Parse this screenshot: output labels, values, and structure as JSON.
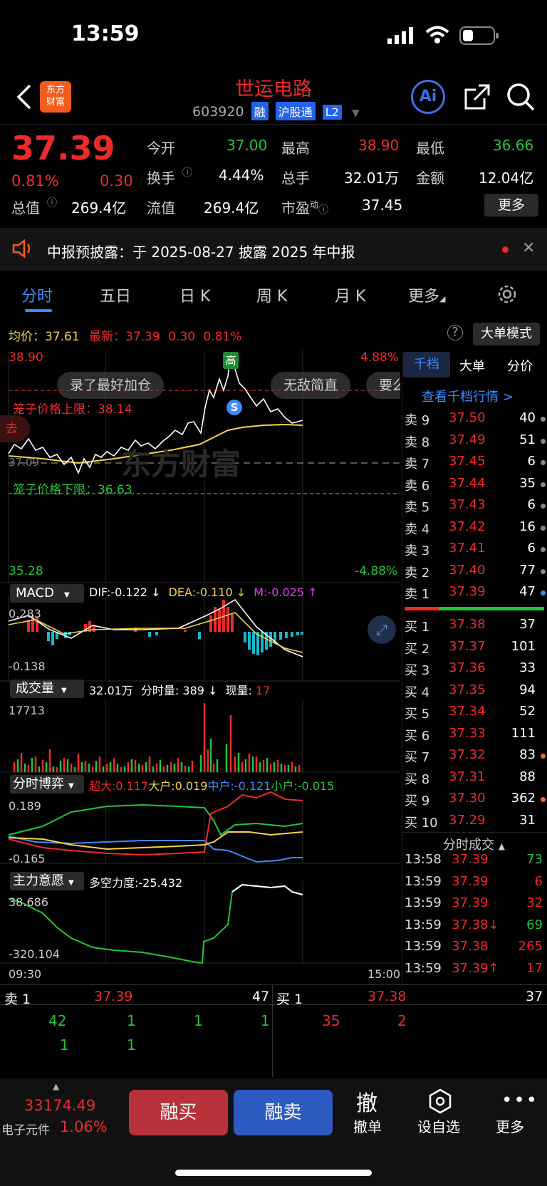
{
  "status_bar": {
    "time": "13:59"
  },
  "header": {
    "logo": "东方\n财富",
    "stock_name": "世运电路",
    "stock_code": "603920",
    "tags": [
      "融",
      "沪股通",
      "L2"
    ],
    "ai": "Ai"
  },
  "quote": {
    "price": "37.39",
    "change_pct": "0.81%",
    "change": "0.30",
    "fields": [
      {
        "label": "今开",
        "value": "37.00"
      },
      {
        "label": "最高",
        "value": "38.90"
      },
      {
        "label": "最低",
        "value": "36.66"
      },
      {
        "label": "换手",
        "value": "4.44%"
      },
      {
        "label": "总手",
        "value": "32.01万"
      },
      {
        "label": "金额",
        "value": "12.04亿"
      },
      {
        "label": "总值",
        "value": "269.4亿"
      },
      {
        "label": "流值",
        "value": "269.4亿"
      },
      {
        "label": "市盈",
        "sup": "动",
        "value": "37.45"
      }
    ],
    "more": "更多"
  },
  "notice": {
    "text": "中报预披露：于 2025-08-27 披露 2025 年中报"
  },
  "tabs": [
    "分时",
    "五日",
    "日 K",
    "周 K",
    "月 K",
    "更多"
  ],
  "intraday": {
    "avg_label": "均价：",
    "avg_value": "37.61",
    "last_label": "最新：",
    "last_value": "37.39",
    "last_change": "0.30",
    "last_pct": "0.81%",
    "big_order_mode": "大单模式",
    "y_top": "38.90",
    "y_bottom": "35.28",
    "pct_top": "4.88%",
    "pct_bottom": "-4.88%",
    "high_marker": "高",
    "s_marker": "S",
    "upper_limit": "笼子价格上限：38.14",
    "lower_limit": "笼子价格下限：36.63",
    "mid_price": "37.09",
    "bubbles": [
      "录了最好加仓",
      "无敌简直",
      "要么"
    ],
    "watermark": "东方财富",
    "time_start": "09:30",
    "time_end": "15:00",
    "side_label": "去"
  },
  "macd": {
    "name": "MACD",
    "dif": "DIF:-0.122 ↓",
    "dea": "DEA:-0.110 ↓",
    "m": "M:-0.025 ↑",
    "y_top": "0.283",
    "y_bottom": "-0.138"
  },
  "volume": {
    "name": "成交量",
    "total": "32.01万",
    "min_label": "分时量: 389 ↓",
    "cur_label": "现量:",
    "cur_value": "17",
    "y_top": "17713"
  },
  "game": {
    "name": "分时博弈",
    "super": "超大:0.117",
    "big": "大户:0.019",
    "mid": "中户:-0.121",
    "small": "小户:-0.015",
    "y_top": "0.189",
    "y_bottom": "-0.165"
  },
  "main_force": {
    "name": "主力意愿",
    "force": "多空力度:-25.432",
    "y_top": "38.686",
    "y_bottom": "-320.104"
  },
  "side_tabs": [
    "千档",
    "大单",
    "分价"
  ],
  "view_levels": "查看千档行情 >",
  "asks": [
    {
      "label": "卖 9",
      "price": "37.50",
      "vol": "40"
    },
    {
      "label": "卖 8",
      "price": "37.49",
      "vol": "51"
    },
    {
      "label": "卖 7",
      "price": "37.45",
      "vol": "6"
    },
    {
      "label": "卖 6",
      "price": "37.44",
      "vol": "35"
    },
    {
      "label": "卖 5",
      "price": "37.43",
      "vol": "6"
    },
    {
      "label": "卖 4",
      "price": "37.42",
      "vol": "16"
    },
    {
      "label": "卖 3",
      "price": "37.41",
      "vol": "6"
    },
    {
      "label": "卖 2",
      "price": "37.40",
      "vol": "77"
    },
    {
      "label": "卖 1",
      "price": "37.39",
      "vol": "47"
    }
  ],
  "bids": [
    {
      "label": "买 1",
      "price": "37.38",
      "vol": "37"
    },
    {
      "label": "买 2",
      "price": "37.37",
      "vol": "101"
    },
    {
      "label": "买 3",
      "price": "37.36",
      "vol": "33"
    },
    {
      "label": "买 4",
      "price": "37.35",
      "vol": "94"
    },
    {
      "label": "买 5",
      "price": "37.34",
      "vol": "52"
    },
    {
      "label": "买 6",
      "price": "37.33",
      "vol": "111"
    },
    {
      "label": "买 7",
      "price": "37.32",
      "vol": "83"
    },
    {
      "label": "买 8",
      "price": "37.31",
      "vol": "88"
    },
    {
      "label": "买 9",
      "price": "37.30",
      "vol": "362"
    },
    {
      "label": "买 10",
      "price": "37.29",
      "vol": "31"
    }
  ],
  "trades_title": "分时成交",
  "trades": [
    {
      "time": "13:58",
      "price": "37.39",
      "vol": "73"
    },
    {
      "time": "13:59",
      "price": "37.39",
      "vol": "6"
    },
    {
      "time": "13:59",
      "price": "37.39",
      "vol": "32"
    },
    {
      "time": "13:59",
      "price": "37.38↓",
      "vol": "69"
    },
    {
      "time": "13:59",
      "price": "37.38",
      "vol": "265"
    },
    {
      "time": "13:59",
      "price": "37.39↑",
      "vol": "17"
    }
  ],
  "bottom_book": {
    "sell_label": "卖 1",
    "sell_price": "37.39",
    "sell_vol": "47",
    "buy_label": "买 1",
    "buy_price": "37.38",
    "buy_vol": "37",
    "sell_queue_row1": [
      "42",
      "1",
      "1",
      "1"
    ],
    "sell_queue_row2": [
      "1",
      "1"
    ],
    "buy_queue_row1": [
      "35",
      "2"
    ]
  },
  "footer": {
    "index_value": "33174.49",
    "index_name": "电子元件",
    "index_pct": "1.06%",
    "margin_buy": "融买",
    "margin_sell": "融卖",
    "cancel_icon": "撤",
    "cancel": "撤单",
    "watch": "设自选",
    "more": "更多"
  }
}
